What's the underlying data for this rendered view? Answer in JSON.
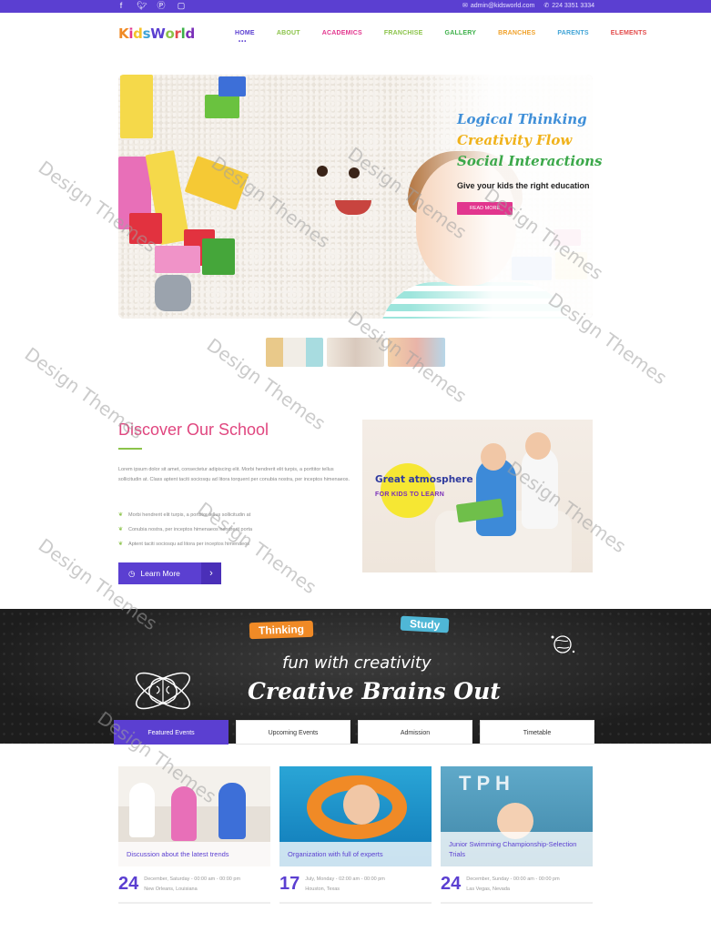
{
  "topbar": {
    "social_icons": [
      "facebook-icon",
      "twitter-icon",
      "pinterest-icon",
      "instagram-icon"
    ],
    "email": "admin@kidsworld.com",
    "phone": "224 3351 3334"
  },
  "header": {
    "logo": "KidsWorld",
    "nav": [
      {
        "label": "HOME",
        "color": "#5b3fd1",
        "active": true
      },
      {
        "label": "ABOUT",
        "color": "#8bc34a"
      },
      {
        "label": "ACADEMICS",
        "color": "#e2368e"
      },
      {
        "label": "FRANCHISE",
        "color": "#8bc34a"
      },
      {
        "label": "GALLERY",
        "color": "#3db04a"
      },
      {
        "label": "BRANCHES",
        "color": "#f0a12a"
      },
      {
        "label": "PARENTS",
        "color": "#3fa3d6"
      },
      {
        "label": "ELEMENTS",
        "color": "#e24a4a"
      }
    ]
  },
  "hero": {
    "lines": [
      {
        "text": "Logical Thinking",
        "color": "#3f8fd8"
      },
      {
        "text": "Creativity Flow",
        "color": "#f0b21a"
      },
      {
        "text": "Social Interactions",
        "color": "#3ba84a"
      }
    ],
    "subtitle": "Give your kids the right education",
    "button": "READ MORE"
  },
  "discover": {
    "title": "Discover Our School",
    "paragraph": "Lorem ipsum dolor sit amet, consectetur adipiscing elit. Morbi hendrerit elit turpis, a porttitor tellus sollicitudin at. Class aptent taciti sociosqu ad litora torquent per conubia nostra, per inceptos himenaeos.",
    "bullets": [
      "Morbi hendrerit elit turpis, a porttitor tellus sollicitudin at",
      "Conubia nostra, per inceptos himenaeos hendrerit porta",
      "Aptent taciti sociosqu ad litora per inceptos himenaeos"
    ],
    "button": "Learn More",
    "photo_line1": "Great atmosphere",
    "photo_line2": "FOR KIDS TO LEARN"
  },
  "band": {
    "tag1": "Thinking",
    "tag2": "Study",
    "line1": "fun with creativity",
    "line2": "Creative Brains Out"
  },
  "tabs": [
    {
      "label": "Featured Events",
      "active": true
    },
    {
      "label": "Upcoming Events"
    },
    {
      "label": "Admission"
    },
    {
      "label": "Timetable"
    }
  ],
  "events": [
    {
      "caption": "Discussion about the latest trends",
      "day": "24",
      "line1": "December, Saturday - 00:00 am - 00:00 pm",
      "line2": "New Orleans, Louisiana"
    },
    {
      "caption": "Organization with full of experts",
      "day": "17",
      "line1": "July, Monday - 02:00 am - 00:00 pm",
      "line2": "Houston, Texas"
    },
    {
      "caption": "Junior Swimming Championship-Selection Trials",
      "day": "24",
      "line1": "December, Sunday - 00:00 am - 00:00 pm",
      "line2": "Las Vegas, Nevada"
    }
  ],
  "watermark": "Design Themes"
}
